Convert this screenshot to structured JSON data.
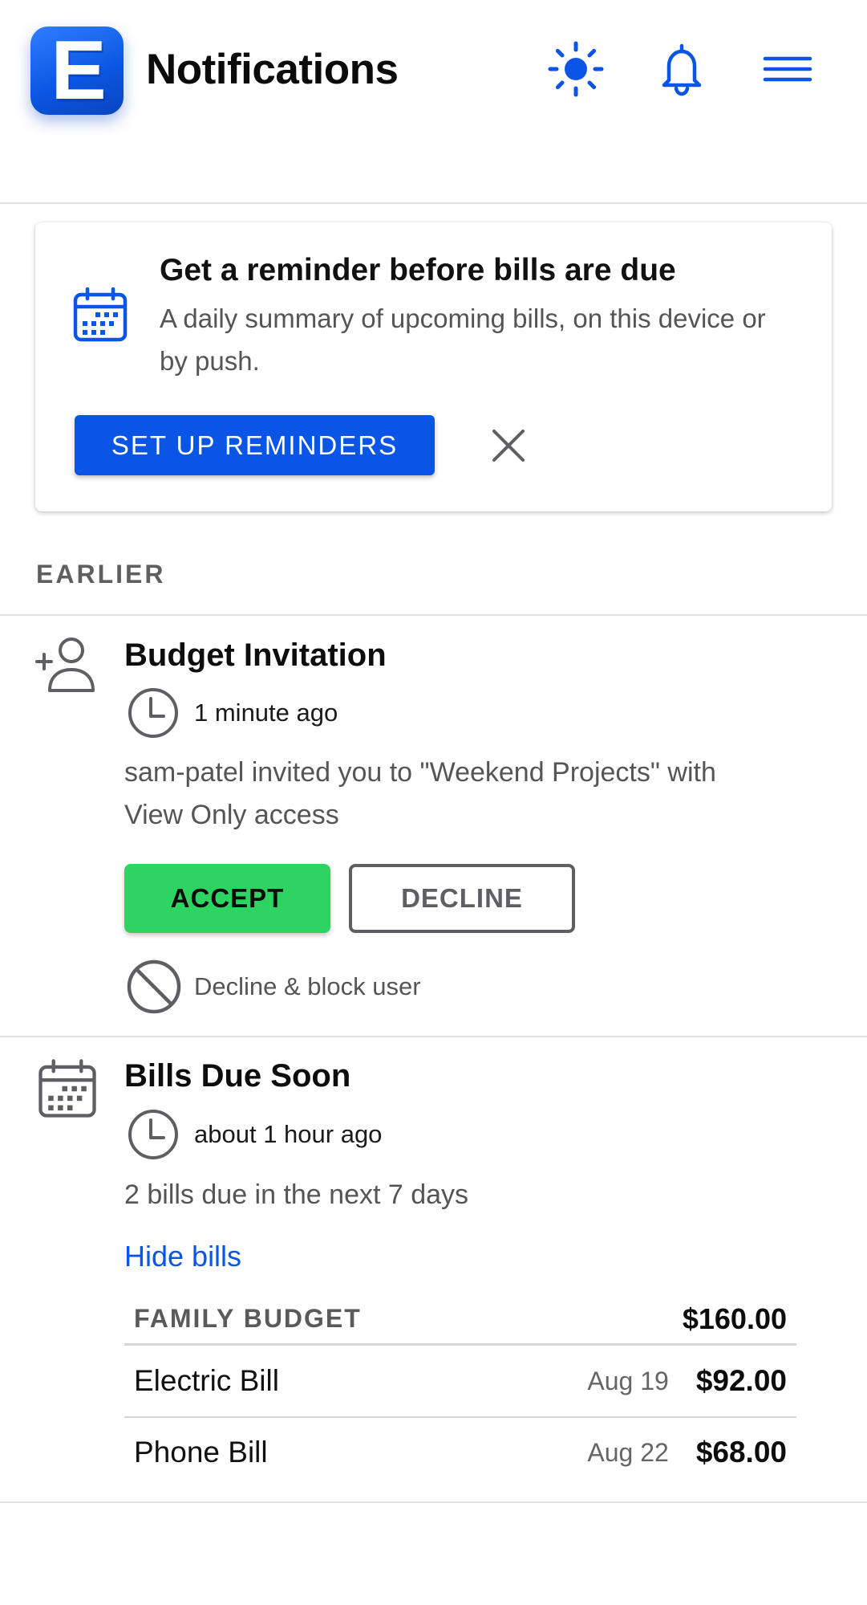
{
  "header": {
    "logo_letter": "E",
    "title": "Notifications",
    "icons": [
      "sun-icon",
      "bell-icon",
      "menu-icon"
    ]
  },
  "reminder_card": {
    "icon": "calendar-icon",
    "title": "Get a reminder before bills are due",
    "body": "A daily summary of upcoming bills, on this device or by push.",
    "button_label": "SET UP REMINDERS",
    "dismiss_icon": "close-icon"
  },
  "section_label": "EARLIER",
  "notifications": [
    {
      "icon": "add-user-icon",
      "title": "Budget Invitation",
      "time": "1 minute ago",
      "body": "sam-patel invited you to \"Weekend Projects\" with View Only access",
      "accept_label": "ACCEPT",
      "decline_label": "DECLINE",
      "block_label": "Decline & block user"
    },
    {
      "icon": "calendar-icon",
      "title": "Bills Due Soon",
      "time": "about 1 hour ago",
      "body": "2 bills due in the next 7 days",
      "toggle_label": "Hide bills",
      "bills": {
        "group": "FAMILY BUDGET",
        "total": "$160.00",
        "rows": [
          {
            "name": "Electric Bill",
            "date": "Aug 19",
            "amount": "$92.00"
          },
          {
            "name": "Phone Bill",
            "date": "Aug 22",
            "amount": "$68.00"
          }
        ]
      }
    }
  ],
  "colors": {
    "accent": "#0a55e6",
    "accept": "#2dd461",
    "muted_text": "#555555",
    "divider": "#e2e2e2"
  }
}
